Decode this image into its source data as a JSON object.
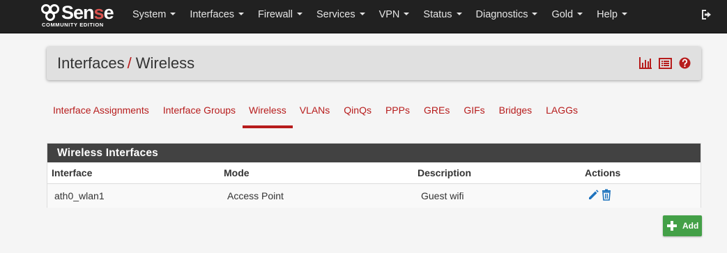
{
  "brand": {
    "logo_prefix": "Sen",
    "logo_red": "s",
    "logo_suffix": "e",
    "edition": "COMMUNITY EDITION"
  },
  "nav": {
    "items": [
      {
        "label": "System"
      },
      {
        "label": "Interfaces"
      },
      {
        "label": "Firewall"
      },
      {
        "label": "Services"
      },
      {
        "label": "VPN"
      },
      {
        "label": "Status"
      },
      {
        "label": "Diagnostics"
      },
      {
        "label": "Gold"
      },
      {
        "label": "Help"
      }
    ],
    "logout_icon": "sign-out-icon"
  },
  "header": {
    "crumb_parent": "Interfaces",
    "crumb_separator": "/",
    "crumb_current": "Wireless",
    "icons": [
      "bar-chart-icon",
      "list-icon",
      "question-circle-icon"
    ]
  },
  "tabs": [
    {
      "label": "Interface Assignments",
      "active": false
    },
    {
      "label": "Interface Groups",
      "active": false
    },
    {
      "label": "Wireless",
      "active": true
    },
    {
      "label": "VLANs",
      "active": false
    },
    {
      "label": "QinQs",
      "active": false
    },
    {
      "label": "PPPs",
      "active": false
    },
    {
      "label": "GREs",
      "active": false
    },
    {
      "label": "GIFs",
      "active": false
    },
    {
      "label": "Bridges",
      "active": false
    },
    {
      "label": "LAGGs",
      "active": false
    }
  ],
  "panel": {
    "title": "Wireless Interfaces",
    "columns": [
      "Interface",
      "Mode",
      "Description",
      "Actions"
    ],
    "rows": [
      {
        "interface": "ath0_wlan1",
        "mode": "Access Point",
        "description": "Guest wifi",
        "actions": [
          "pencil-icon",
          "trash-icon"
        ]
      }
    ]
  },
  "add_button": {
    "label": "Add",
    "icon": "plus-icon"
  },
  "colors": {
    "navbar": "#212121",
    "accent_red": "#b71c1c",
    "panel_heading": "#424242",
    "add_green": "#43a047",
    "action_blue": "#1e73be"
  }
}
